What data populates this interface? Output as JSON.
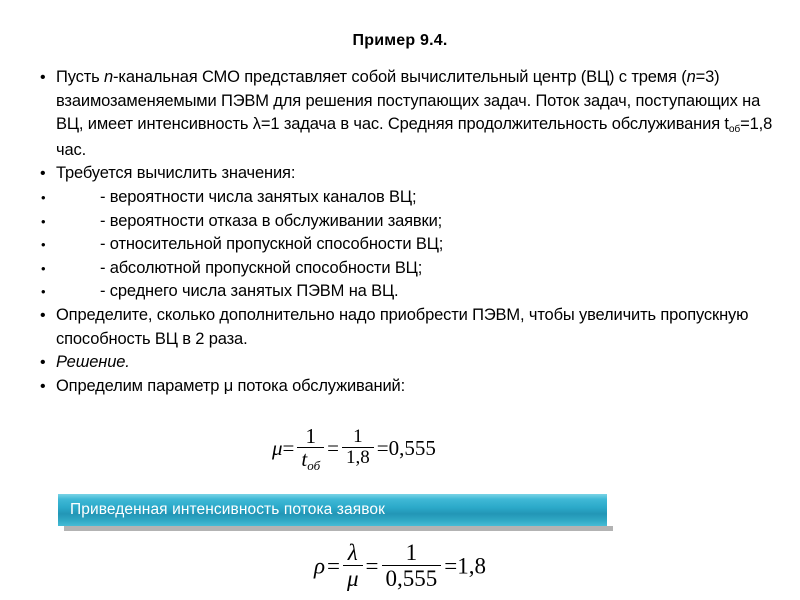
{
  "slide": {
    "title": "Пример 9.4.",
    "bullets": [
      {
        "level": "top",
        "segments": [
          {
            "text": "Пусть ",
            "style": "normal"
          },
          {
            "text": "n",
            "style": "italic"
          },
          {
            "text": "-канальная СМО представляет собой вычислительный центр (ВЦ) с тремя (",
            "style": "normal"
          },
          {
            "text": "n",
            "style": "italic"
          },
          {
            "text": "=3) взаимозаменяемыми ПЭВМ для решения поступающих задач. Поток задач, поступающих на ВЦ, имеет интенсивность λ=1 задача в час. Средняя продолжительность обслуживания t",
            "style": "normal"
          },
          {
            "text": "об",
            "style": "sub"
          },
          {
            "text": "=1,8 час.",
            "style": "normal"
          }
        ],
        "plain": "Пусть n-канальная СМО представляет собой вычислительный центр (ВЦ) с тремя (n=3) взаимозаменяемыми ПЭВМ для решения поступающих задач. Поток задач, поступающих на ВЦ, имеет интенсивность λ=1 задача в час. Средняя продолжительность обслуживания tоб=1,8 час."
      },
      {
        "level": "top",
        "plain": "Требуется вычислить значения:"
      },
      {
        "level": "sub",
        "plain": "- вероятности числа занятых каналов ВЦ;"
      },
      {
        "level": "sub",
        "plain": "- вероятности отказа в обслуживании заявки;"
      },
      {
        "level": "sub",
        "plain": "- относительной пропускной способности ВЦ;"
      },
      {
        "level": "sub",
        "plain": "- абсолютной пропускной способности ВЦ;"
      },
      {
        "level": "sub",
        "plain": "- среднего числа занятых ПЭВМ на ВЦ."
      },
      {
        "level": "top",
        "plain": "Определите, сколько дополнительно надо приобрести ПЭВМ, чтобы увеличить пропускную способность ВЦ в 2 раза."
      },
      {
        "level": "top",
        "plain": "Решение."
      },
      {
        "level": "top",
        "plain": "Определим параметр μ потока обслуживаний:"
      }
    ]
  },
  "formulas": {
    "mu": {
      "lhs": "μ",
      "eq1": "=",
      "frac1_num": "1",
      "frac1_den": "t",
      "frac1_den_sub": "об",
      "eq2": "=",
      "frac2_num": "1",
      "frac2_den": "1,8",
      "eq3": "=",
      "result": "0,555"
    },
    "rho": {
      "lhs": "ρ",
      "eq1": "=",
      "frac1_num": "λ",
      "frac1_den": "μ",
      "eq2": "=",
      "frac2_num": "1",
      "frac2_den": "0,555",
      "eq3": "=",
      "result": "1,8"
    }
  },
  "banner": {
    "label": "Приведенная интенсивность потока заявок",
    "gradient_top_color": "#7ad4e6",
    "gradient_mid_color": "#2396b6",
    "gradient_bottom_color": "#46bcd6",
    "text_color": "#ffffff",
    "shadow_color": "#a6a6a6"
  }
}
